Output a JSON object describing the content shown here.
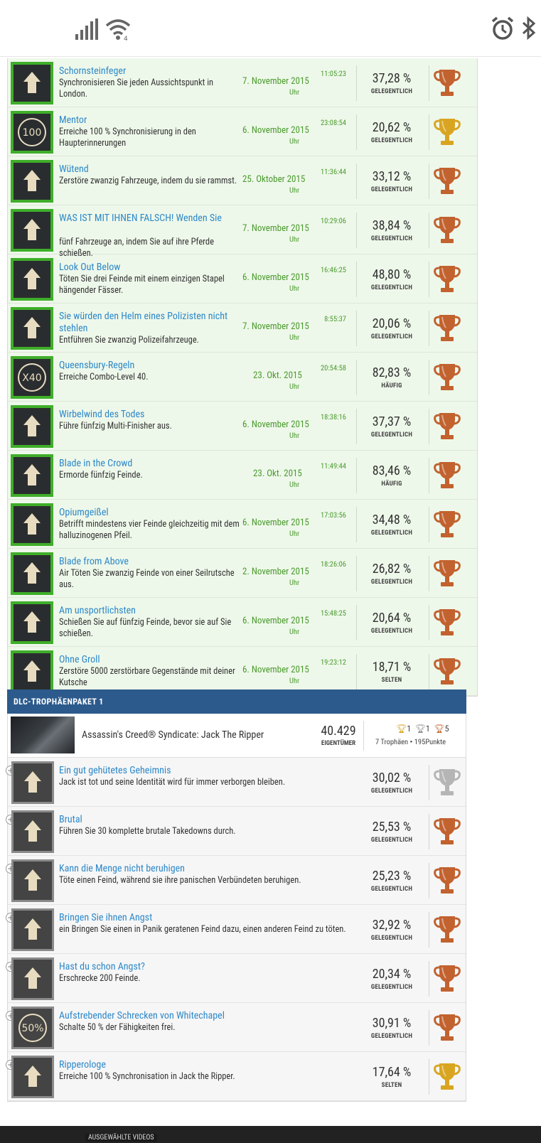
{
  "earned": [
    {
      "title": "Schornsteinfeger",
      "desc": "Synchronisieren Sie jeden Aussichtspunkt in London.",
      "date": "7. November 2015",
      "time": "11:05:23",
      "uhr": "Uhr",
      "pct": "37,28 %",
      "rarity": "GELEGENTLICH",
      "trophy": "bronze",
      "icon": "eagle-icon"
    },
    {
      "title": "Mentor",
      "desc": "Erreiche 100 % Synchronisierung in den Haupterinnerungen",
      "date": "6. November 2015",
      "time": "23:08:54",
      "uhr": "Uhr",
      "pct": "20,62 %",
      "rarity": "GELEGENTLICH",
      "trophy": "gold",
      "icon": "hundred-icon",
      "icon_text": "100"
    },
    {
      "title": "Wütend",
      "desc": "Zerstöre zwanzig Fahrzeuge, indem du sie rammst.",
      "date": "25. Oktober 2015",
      "time": "11:36:44",
      "uhr": "Uhr",
      "pct": "33,12 %",
      "rarity": "GELEGENTLICH",
      "trophy": "bronze",
      "icon": "carriage-icon"
    },
    {
      "title": "WAS IST MIT IHNEN FALSCH! Wenden Sie",
      "desc": "fünf Fahrzeuge an, indem Sie auf ihre Pferde schießen.",
      "date": "7. November 2015",
      "time": "10:29:06",
      "uhr": "Uhr",
      "pct": "38,84 %",
      "rarity": "GELEGENTLICH",
      "trophy": "bronze",
      "icon": "flip-carriage-icon"
    },
    {
      "title": "Look Out Below",
      "desc": "Töten Sie drei Feinde mit einem einzigen Stapel hängender Fässer.",
      "date": "6. November 2015",
      "time": "16:46:25",
      "uhr": "Uhr",
      "pct": "48,80 %",
      "rarity": "GELEGENTLICH",
      "trophy": "bronze",
      "icon": "barrels-icon"
    },
    {
      "title": "Sie würden den Helm eines Polizisten nicht stehlen",
      "desc": "Entführen Sie zwanzig Polizeifahrzeuge.",
      "date": "7. November 2015",
      "time": "8:55:37",
      "uhr": "Uhr",
      "pct": "20,06 %",
      "rarity": "GELEGENTLICH",
      "trophy": "bronze",
      "icon": "police-badge-icon"
    },
    {
      "title": "Queensbury-Regeln",
      "desc": "Erreiche Combo-Level 40.",
      "date": "23. Okt. 2015",
      "time": "20:54:58",
      "uhr": "Uhr",
      "pct": "82,83 %",
      "rarity": "HÄUFIG",
      "trophy": "bronze",
      "icon": "x40-icon",
      "icon_text": "X40"
    },
    {
      "title": "Wirbelwind des Todes",
      "desc": "Führe fünfzig Multi-Finisher aus.",
      "date": "6. November 2015",
      "time": "18:38:16",
      "uhr": "Uhr",
      "pct": "37,37 %",
      "rarity": "GELEGENTLICH",
      "trophy": "bronze",
      "icon": "skulls-icon"
    },
    {
      "title": "Blade in the Crowd",
      "desc": "Ermorde fünfzig Feinde.",
      "date": "23. Okt. 2015",
      "time": "11:49:44",
      "uhr": "Uhr",
      "pct": "83,46 %",
      "rarity": "HÄUFIG",
      "trophy": "bronze",
      "icon": "hidden-blade-icon"
    },
    {
      "title": "Opiumgeißel",
      "desc": "Betrifft mindestens vier Feinde gleichzeitig mit dem halluzinogenen Pfeil.",
      "date": "6. November 2015",
      "time": "17:03:56",
      "uhr": "Uhr",
      "pct": "34,48 %",
      "rarity": "GELEGENTLICH",
      "trophy": "bronze",
      "icon": "dart-icon"
    },
    {
      "title": "Blade from Above",
      "desc": "Air Töten Sie zwanzig Feinde von einer Seilrutsche aus.",
      "date": "2. November 2015",
      "time": "18:26:06",
      "uhr": "Uhr",
      "pct": "26,82 %",
      "rarity": "GELEGENTLICH",
      "trophy": "bronze",
      "icon": "skull-arrow-icon"
    },
    {
      "title": "Am unsportlichsten",
      "desc": "Schießen Sie auf fünfzig Feinde, bevor sie auf Sie schießen.",
      "date": "6. November 2015",
      "time": "15:48:25",
      "uhr": "Uhr",
      "pct": "20,64 %",
      "rarity": "GELEGENTLICH",
      "trophy": "bronze",
      "icon": "revolver-icon"
    },
    {
      "title": "Ohne Groll",
      "desc": "Zerstöre 5000 zerstörbare Gegenstände mit deiner Kutsche",
      "date": "6. November 2015",
      "time": "19:23:12",
      "uhr": "Uhr",
      "pct": "18,71 %",
      "rarity": "SELTEN",
      "trophy": "bronze",
      "icon": "shatter-icon"
    }
  ],
  "dlc": {
    "header": "DLC-TROPHÄENPAKET 1",
    "name": "Assassin's Creed® Syndicate: Jack The Ripper",
    "owners": "40.429",
    "owners_label": "EIGENTÜMER",
    "gold": "1",
    "silver": "1",
    "bronze": "5",
    "trophies_text": "7 Trophäen",
    "points": "195",
    "points_label": "Punkte",
    "items": [
      {
        "title": "Ein gut gehütetes Geheimnis",
        "desc": "Jack ist tot und seine Identität wird für immer verborgen bleiben.",
        "pct": "30,02 %",
        "rarity": "GELEGENTLICH",
        "trophy": "silver",
        "icon": "tombstone-icon"
      },
      {
        "title": "Brutal",
        "desc": "Führen Sie 30 komplette brutale Takedowns durch.",
        "pct": "25,53 %",
        "rarity": "GELEGENTLICH",
        "trophy": "bronze",
        "icon": "fist-icon"
      },
      {
        "title": "Kann die Menge nicht beruhigen",
        "desc": "Töte einen Feind, während sie ihre panischen Verbündeten beruhigen.",
        "pct": "25,23 %",
        "rarity": "GELEGENTLICH",
        "trophy": "bronze",
        "icon": "no-calm-icon"
      },
      {
        "title": "Bringen Sie ihnen Angst",
        "desc": "ein Bringen Sie einen in Panik geratenen Feind dazu, einen anderen Feind zu töten.",
        "pct": "32,92 %",
        "rarity": "GELEGENTLICH",
        "trophy": "bronze",
        "icon": "shooter-icon"
      },
      {
        "title": "Hast du schon Angst?",
        "desc": "Erschrecke 200 Feinde.",
        "pct": "20,34 %",
        "rarity": "GELEGENTLICH",
        "trophy": "bronze",
        "icon": "scared-faces-icon"
      },
      {
        "title": "Aufstrebender Schrecken von Whitechapel",
        "desc": "Schalte 50 % der Fähigkeiten frei.",
        "pct": "30,91 %",
        "rarity": "GELEGENTLICH",
        "trophy": "bronze",
        "icon": "fifty-percent-icon",
        "icon_text": "50%"
      },
      {
        "title": "Ripperologe",
        "desc": "Erreiche 100 % Synchronisation in Jack the Ripper.",
        "pct": "17,64 %",
        "rarity": "SELTEN",
        "trophy": "gold",
        "icon": "ripper-icon"
      }
    ]
  },
  "footer": {
    "label": "AUSGEWÄHLTE VIDEOS"
  },
  "colors": {
    "gold": "#d9a521",
    "silver": "#b5b5b5",
    "bronze": "#c2622f",
    "link": "#2d88c9",
    "earned_bg": "#eef8ea",
    "earned_border": "#3fae2a",
    "dlc_header": "#2c5a8c"
  }
}
